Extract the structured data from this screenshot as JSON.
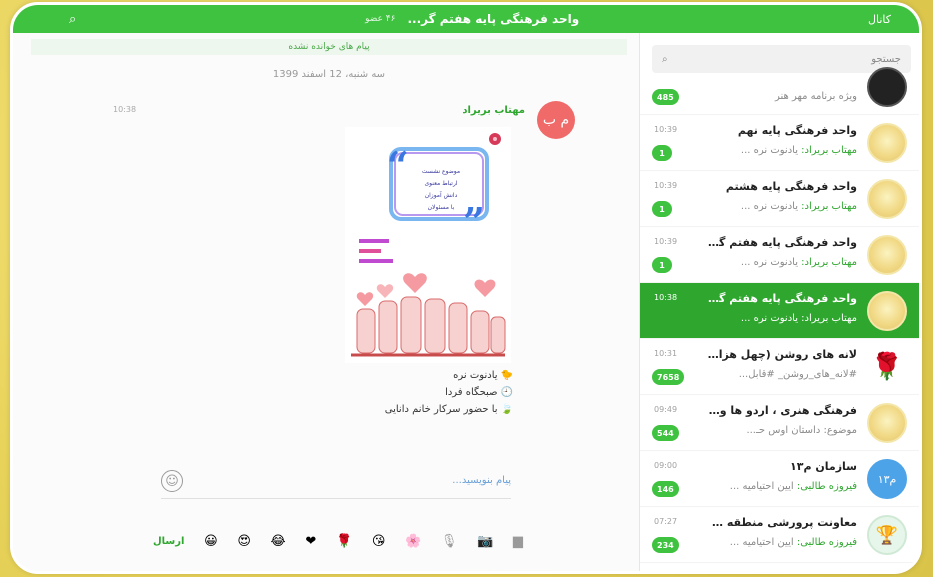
{
  "topbar": {
    "title": "واحد فرهنگی پایه هفتم گر...",
    "status": "۴۶ عضو",
    "left_label": "کانال",
    "right_icon": "search-icon"
  },
  "sidebar": {
    "search_placeholder": "جستجو",
    "chats": [
      {
        "name": "",
        "preview": "ویژه برنامه مهر هنر",
        "time": "",
        "badge": "485",
        "avatar": "dark"
      },
      {
        "name": "واحد فرهنگی پایه نهم",
        "sender": "مهتاب بریراد:",
        "preview": "یادنوت نره ...",
        "time": "10:39",
        "badge": "1",
        "avatar": "gold"
      },
      {
        "name": "واحد فرهنگی پایه هشتم",
        "sender": "مهتاب بریراد:",
        "preview": "یادنوت نره ...",
        "time": "10:39",
        "badge": "1",
        "avatar": "gold"
      },
      {
        "name": "واحد فرهنگی پایه هفتم گرو...",
        "sender": "مهتاب بریراد:",
        "preview": "یادنوت نره ...",
        "time": "10:39",
        "badge": "1",
        "avatar": "gold"
      },
      {
        "name": "واحد فرهنگی پایه هفتم گرو...",
        "sender": "مهتاب بریراد:",
        "preview": "یادنوت نره ...",
        "time": "10:38",
        "badge": "",
        "avatar": "gold",
        "active": true
      },
      {
        "name": "لانه های روشن (چهل هزار...",
        "sender": "",
        "preview": "#لانه_های_روشن_ #قابل...",
        "time": "10:31",
        "badge": "7658",
        "avatar": "rose"
      },
      {
        "name": "فرهنگی هنری ، اردو ها و ف...",
        "sender": "",
        "preview": "موضوع: داستان اوس حـ...",
        "time": "09:49",
        "badge": "544",
        "avatar": "gold"
      },
      {
        "name": "سازمان م۱۳",
        "sender": "فیروزه طالبی:",
        "preview": "آیین احتیامیه ...",
        "time": "09:00",
        "badge": "146",
        "avatar": "blue"
      },
      {
        "name": "معاونت پرورشی منطقه 13د...",
        "sender": "فیروزه طالبی:",
        "preview": "آیین احتیامیه ...",
        "time": "07:27",
        "badge": "234",
        "avatar": "trophy"
      }
    ]
  },
  "main": {
    "unread_label": "پیام های خوانده نشده",
    "date": "سه شنبه، 12 اسفند 1399",
    "message": {
      "sender": "مهتاب بریراد",
      "avatar_initials": "م ب",
      "time": "10:38",
      "caption_lines": [
        "یادنوت نره",
        "صبحگاه فردا",
        "با حضور سرکار خانم دانایی"
      ],
      "poster_texts": [
        "موضوع نشست",
        "ارتباط معنوی",
        "دانش آموزان",
        "با مسئولان"
      ]
    },
    "composer_placeholder": "پیام بنویسید...",
    "send_label": "ارسال"
  }
}
